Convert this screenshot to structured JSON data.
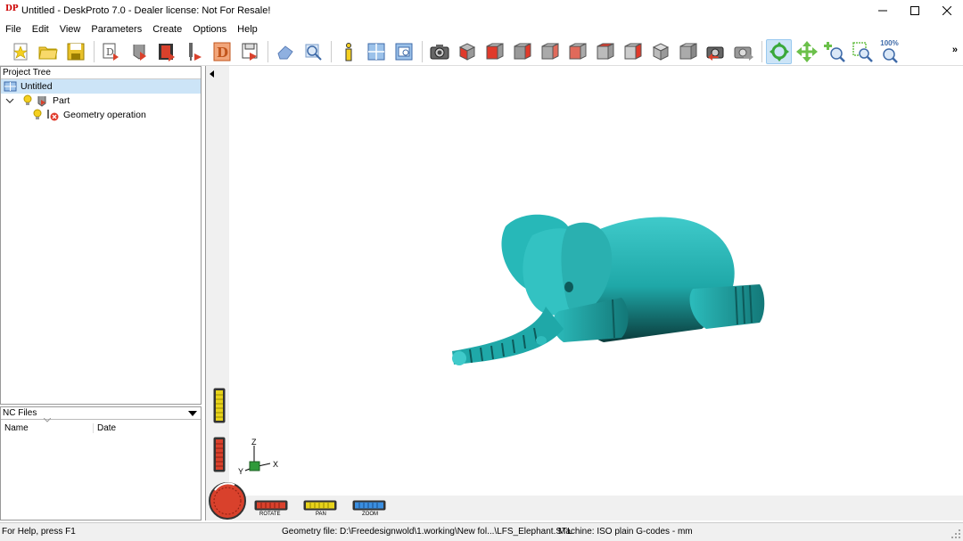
{
  "window": {
    "title": "Untitled - DeskProto 7.0 - Dealer license: Not For Resale!",
    "logo_text": "DP"
  },
  "menu": [
    "File",
    "Edit",
    "View",
    "Parameters",
    "Create",
    "Options",
    "Help"
  ],
  "toolbar": {
    "zoom_label": "100%",
    "overflow": "»"
  },
  "project_tree": {
    "header": "Project Tree",
    "items": [
      {
        "label": "Untitled"
      },
      {
        "label": "Part"
      },
      {
        "label": "Geometry operation"
      }
    ]
  },
  "nc_files": {
    "header": "NC Files",
    "columns": [
      "Name",
      "Date"
    ]
  },
  "viewport": {
    "model_color": "#29b3b3",
    "axes": {
      "z": "Z",
      "y": "Y",
      "x": "X"
    },
    "controls": {
      "rotate": "ROTATE",
      "pan": "PAN",
      "zoom": "ZOOM"
    }
  },
  "statusbar": {
    "help": "For Help, press F1",
    "geometry": "Geometry file: D:\\Freedesignwold\\1.working\\New fol...\\LFS_Elephant.STL",
    "machine": "Machine: ISO plain G-codes - mm"
  }
}
